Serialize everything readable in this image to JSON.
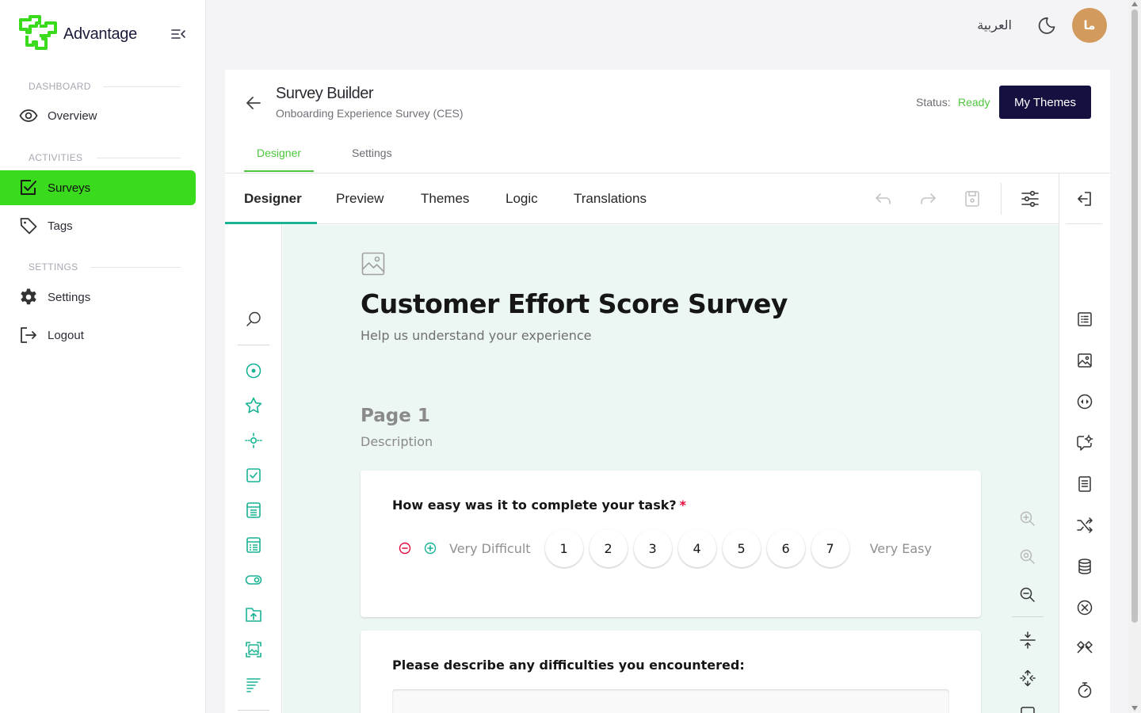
{
  "app": {
    "name": "Advantage"
  },
  "topbar": {
    "language": "العربية",
    "avatar_initials": "ما"
  },
  "sidebar": {
    "sections": [
      {
        "label": "DASHBOARD",
        "items": [
          {
            "label": "Overview",
            "icon": "eye-icon"
          }
        ]
      },
      {
        "label": "ACTIVITIES",
        "items": [
          {
            "label": "Surveys",
            "icon": "checkbox-icon",
            "active": true
          },
          {
            "label": "Tags",
            "icon": "tag-icon"
          }
        ]
      },
      {
        "label": "SETTINGS",
        "items": [
          {
            "label": "Settings",
            "icon": "gear-icon"
          },
          {
            "label": "Logout",
            "icon": "logout-icon"
          }
        ]
      }
    ]
  },
  "header": {
    "title": "Survey Builder",
    "subtitle": "Onboarding Experience Survey (CES)",
    "status_label": "Status:",
    "status_value": "Ready",
    "my_themes_label": "My Themes",
    "tabs": [
      {
        "label": "Designer",
        "active": true
      },
      {
        "label": "Settings"
      }
    ]
  },
  "creator": {
    "tabs": [
      {
        "label": "Designer",
        "active": true
      },
      {
        "label": "Preview"
      },
      {
        "label": "Themes"
      },
      {
        "label": "Logic"
      },
      {
        "label": "Translations"
      }
    ]
  },
  "survey": {
    "title": "Customer Effort Score Survey",
    "description": "Help us understand your experience",
    "page": {
      "title": "Page 1",
      "description": "Description"
    },
    "questions": [
      {
        "title": "How easy was it to complete your task?",
        "required_mark": "*",
        "type": "rating",
        "min_label": "Very Difficult",
        "max_label": "Very Easy",
        "rate_values": [
          "1",
          "2",
          "3",
          "4",
          "5",
          "6",
          "7"
        ]
      },
      {
        "title": "Please describe any difficulties you encountered:",
        "type": "comment"
      }
    ]
  },
  "colors": {
    "brand_green": "#3adb1d",
    "accent_teal": "#19b394",
    "status_ready": "#4dc73c",
    "button_dark": "#141040",
    "required": "#e50a3e",
    "surface": "#ecf6f3"
  }
}
